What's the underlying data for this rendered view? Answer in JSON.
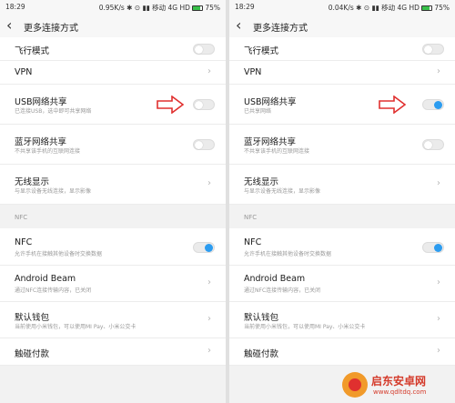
{
  "screens": [
    {
      "status": {
        "time": "18:29",
        "speed": "0.95K/s",
        "network": "移动 4G HD",
        "battery": "75%",
        "battery_level": 0.75
      },
      "title": "更多连接方式",
      "items": [
        {
          "label": "飞行模式",
          "sub": "",
          "control": "toggle",
          "on": false
        },
        {
          "label": "VPN",
          "sub": "",
          "control": "chevron"
        },
        {
          "label": "USB网络共享",
          "sub": "已连接USB，选中即可共享网络",
          "control": "toggle",
          "on": false
        },
        {
          "label": "蓝牙网络共享",
          "sub": "不共享该手机的互联网连接",
          "control": "toggle",
          "on": false
        },
        {
          "label": "无线显示",
          "sub": "与显示设备无线连接，显示影像",
          "control": "chevron"
        }
      ],
      "nfc_header": "NFC",
      "nfc_items": [
        {
          "label": "NFC",
          "sub": "允许手机在接触其他设备时交换数据",
          "control": "toggle",
          "on": true
        },
        {
          "label": "Android Beam",
          "sub": "通过NFC连接传输内容，已关闭",
          "control": "chevron"
        },
        {
          "label": "默认钱包",
          "sub": "当前使用小米钱包，可以使用MI Pay、小米公交卡",
          "control": "chevron"
        },
        {
          "label": "触碰付款",
          "sub": "",
          "control": "chevron"
        }
      ]
    },
    {
      "status": {
        "time": "18:29",
        "speed": "0.04K/s",
        "network": "移动 4G HD",
        "battery": "75%",
        "battery_level": 0.75
      },
      "title": "更多连接方式",
      "items": [
        {
          "label": "飞行模式",
          "sub": "",
          "control": "toggle",
          "on": false
        },
        {
          "label": "VPN",
          "sub": "",
          "control": "chevron"
        },
        {
          "label": "USB网络共享",
          "sub": "已共享网络",
          "control": "toggle",
          "on": true
        },
        {
          "label": "蓝牙网络共享",
          "sub": "不共享该手机的互联网连接",
          "control": "toggle",
          "on": false
        },
        {
          "label": "无线显示",
          "sub": "与显示设备无线连接，显示影像",
          "control": "chevron"
        }
      ],
      "nfc_header": "NFC",
      "nfc_items": [
        {
          "label": "NFC",
          "sub": "允许手机在接触其他设备时交换数据",
          "control": "toggle",
          "on": true
        },
        {
          "label": "Android Beam",
          "sub": "通过NFC连接传输内容，已关闭",
          "control": "chevron"
        },
        {
          "label": "默认钱包",
          "sub": "当前使用小米钱包，可以使用MI Pay、小米公交卡",
          "control": "chevron"
        },
        {
          "label": "触碰付款",
          "sub": "",
          "control": "chevron"
        }
      ]
    }
  ],
  "colors": {
    "accent": "#2c9cf0",
    "arrow": "#e0302f",
    "separator": "#ececec",
    "section_bg": "#f2f2f2"
  },
  "watermark": {
    "name": "启东安卓网",
    "url": "www.qdltdq.com"
  }
}
